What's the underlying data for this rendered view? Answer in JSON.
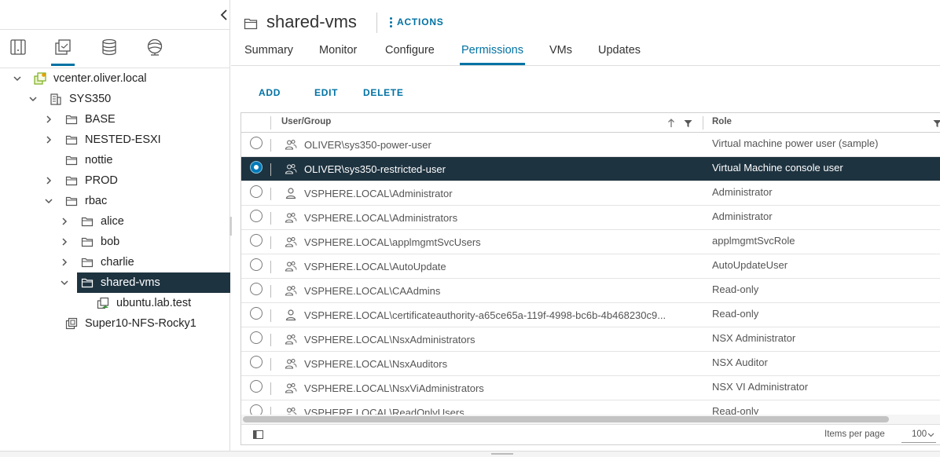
{
  "sidebar": {
    "nav_tabs": [
      {
        "name": "hosts-clusters-tab",
        "icon": "hosts-clusters-icon"
      },
      {
        "name": "vms-templates-tab",
        "icon": "vms-templates-icon",
        "active": true
      },
      {
        "name": "storage-tab",
        "icon": "storage-icon"
      },
      {
        "name": "networking-tab",
        "icon": "networking-icon"
      }
    ],
    "tree": [
      {
        "label": "vcenter.oliver.local",
        "icon": "vcenter-icon",
        "expanded": true
      },
      {
        "label": "SYS350",
        "icon": "datacenter-icon",
        "expanded": true
      },
      {
        "label": "BASE",
        "icon": "folder-icon",
        "expanded": false
      },
      {
        "label": "NESTED-ESXI",
        "icon": "folder-icon",
        "expanded": false
      },
      {
        "label": "nottie",
        "icon": "folder-icon"
      },
      {
        "label": "PROD",
        "icon": "folder-icon",
        "expanded": false
      },
      {
        "label": "rbac",
        "icon": "folder-icon",
        "expanded": true
      },
      {
        "label": "alice",
        "icon": "folder-icon",
        "expanded": false
      },
      {
        "label": "bob",
        "icon": "folder-icon",
        "expanded": false
      },
      {
        "label": "charlie",
        "icon": "folder-icon",
        "expanded": false
      },
      {
        "label": "shared-vms",
        "icon": "folder-icon",
        "expanded": true,
        "selected": true
      },
      {
        "label": "ubuntu.lab.test",
        "icon": "vm-icon"
      },
      {
        "label": "Super10-NFS-Rocky1",
        "icon": "vm-template-icon"
      }
    ]
  },
  "header": {
    "title": "shared-vms",
    "actions_label": "ACTIONS",
    "tabs": [
      "Summary",
      "Monitor",
      "Configure",
      "Permissions",
      "VMs",
      "Updates"
    ],
    "active_tab": "Permissions"
  },
  "toolbar": {
    "add": "ADD",
    "edit": "EDIT",
    "delete": "DELETE"
  },
  "grid": {
    "columns": {
      "user": "User/Group",
      "role": "Role"
    },
    "rows": [
      {
        "user": "OLIVER\\sys350-power-user",
        "role": "Virtual machine power user (sample)",
        "type": "group"
      },
      {
        "user": "OLIVER\\sys350-restricted-user",
        "role": "Virtual Machine console user",
        "type": "group",
        "selected": true
      },
      {
        "user": "VSPHERE.LOCAL\\Administrator",
        "role": "Administrator",
        "type": "user"
      },
      {
        "user": "VSPHERE.LOCAL\\Administrators",
        "role": "Administrator",
        "type": "group"
      },
      {
        "user": "VSPHERE.LOCAL\\applmgmtSvcUsers",
        "role": "applmgmtSvcRole",
        "type": "group"
      },
      {
        "user": "VSPHERE.LOCAL\\AutoUpdate",
        "role": "AutoUpdateUser",
        "type": "group"
      },
      {
        "user": "VSPHERE.LOCAL\\CAAdmins",
        "role": "Read-only",
        "type": "group"
      },
      {
        "user": "VSPHERE.LOCAL\\certificateauthority-a65ce65a-119f-4998-bc6b-4b468230c9...",
        "role": "Read-only",
        "type": "user"
      },
      {
        "user": "VSPHERE.LOCAL\\NsxAdministrators",
        "role": "NSX Administrator",
        "type": "group"
      },
      {
        "user": "VSPHERE.LOCAL\\NsxAuditors",
        "role": "NSX Auditor",
        "type": "group"
      },
      {
        "user": "VSPHERE.LOCAL\\NsxViAdministrators",
        "role": "NSX VI Administrator",
        "type": "group"
      },
      {
        "user": "VSPHERE.LOCAL\\ReadOnlyUsers",
        "role": "Read-only",
        "type": "group"
      }
    ],
    "footer": {
      "items_per_page_label": "Items per page",
      "items_per_page": "100"
    }
  },
  "colors": {
    "accent": "#0072a3",
    "selection": "#1e3340"
  }
}
